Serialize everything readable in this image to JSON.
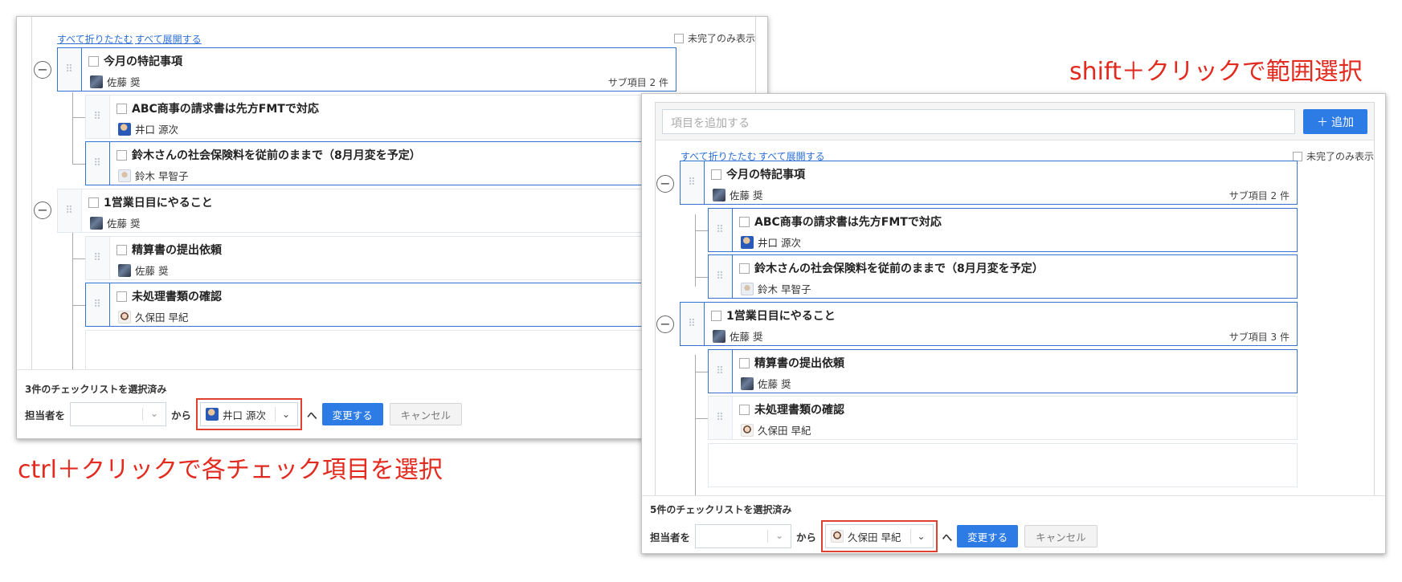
{
  "left": {
    "collapse_all": "すべて折りたたむ",
    "expand_all": "すべて展開する",
    "incomplete_only": "未完了のみ表示",
    "items": [
      {
        "title": "今月の特記事項",
        "assignee": "佐藤 奨",
        "subcount": "サブ項目 2 件"
      },
      {
        "title": "ABC商事の請求書は先方FMTで対応",
        "assignee": "井口 源次"
      },
      {
        "title": "鈴木さんの社会保険料を従前のままで（8月月変を予定）",
        "assignee": "鈴木 早智子"
      },
      {
        "title": "1営業日目にやること",
        "assignee": "佐藤 奨"
      },
      {
        "title": "精算書の提出依頼",
        "assignee": "佐藤 奨"
      },
      {
        "title": "未処理書類の確認",
        "assignee": "久保田 早紀"
      }
    ],
    "footer": {
      "selected_text": "3件のチェックリストを選択済み",
      "assignee_label": "担当者を",
      "from_label": "から",
      "from_value": "井口 源次",
      "to_label": "へ",
      "change_button": "変更する",
      "cancel_button": "キャンセル"
    }
  },
  "right": {
    "add_placeholder": "項目を追加する",
    "add_button": "追加",
    "collapse_all": "すべて折りたたむ",
    "expand_all": "すべて展開する",
    "incomplete_only": "未完了のみ表示",
    "items": [
      {
        "title": "今月の特記事項",
        "assignee": "佐藤 奨",
        "subcount": "サブ項目 2 件"
      },
      {
        "title": "ABC商事の請求書は先方FMTで対応",
        "assignee": "井口 源次"
      },
      {
        "title": "鈴木さんの社会保険料を従前のままで（8月月変を予定）",
        "assignee": "鈴木 早智子"
      },
      {
        "title": "1営業日目にやること",
        "assignee": "佐藤 奨",
        "subcount": "サブ項目 3 件"
      },
      {
        "title": "精算書の提出依頼",
        "assignee": "佐藤 奨"
      },
      {
        "title": "未処理書類の確認",
        "assignee": "久保田 早紀"
      }
    ],
    "footer": {
      "selected_text": "5件のチェックリストを選択済み",
      "assignee_label": "担当者を",
      "from_label": "から",
      "from_value": "久保田 早紀",
      "to_label": "へ",
      "change_button": "変更する",
      "cancel_button": "キャンセル"
    }
  },
  "captions": {
    "ctrl": "ctrl＋クリックで各チェック項目を選択",
    "shift": "shift＋クリックで範囲選択"
  },
  "colors": {
    "accent": "#2d7be5",
    "annotation": "#e32a1f",
    "selected_border": "#3473d3"
  },
  "icons": {
    "drag_handle": "drag-handle-icon",
    "collapse": "minus-circle-icon",
    "chevron": "chevron-down-icon",
    "plus": "plus-icon"
  }
}
